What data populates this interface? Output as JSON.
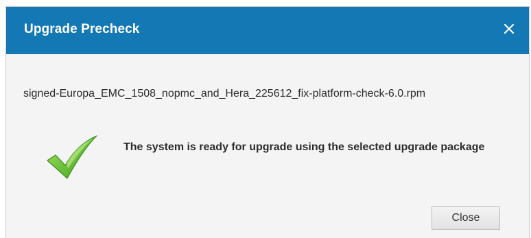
{
  "dialog": {
    "title": "Upgrade Precheck",
    "filename": "signed-Europa_EMC_1508_nopmc_and_Hera_225612_fix-platform-check-6.0.rpm",
    "message": "The system is ready for upgrade using the selected upgrade package",
    "close_button_label": "Close",
    "title_close_icon": "close-icon",
    "status_icon": "checkmark-icon"
  },
  "colors": {
    "titlebar": "#1378b4",
    "check_green": "#5cb531"
  }
}
